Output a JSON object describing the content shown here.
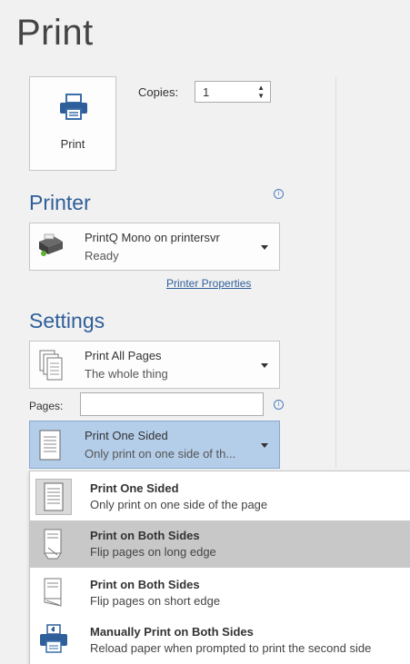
{
  "page": {
    "title": "Print"
  },
  "print_button": {
    "label": "Print",
    "icon": "printer-icon"
  },
  "copies": {
    "label": "Copies:",
    "value": "1"
  },
  "printer": {
    "section_title": "Printer",
    "name": "PrintQ Mono on printersvr",
    "status": "Ready",
    "properties_link": "Printer Properties"
  },
  "settings": {
    "section_title": "Settings",
    "pages_dropdown": {
      "title": "Print All Pages",
      "subtitle": "The whole thing"
    },
    "pages_field": {
      "label": "Pages:",
      "value": ""
    },
    "sides_dropdown": {
      "title": "Print One Sided",
      "subtitle": "Only print on one side of th..."
    }
  },
  "sides_menu": {
    "items": [
      {
        "title": "Print One Sided",
        "subtitle": "Only print on one side of the page",
        "icon": "one-sided-page-icon",
        "state": "selected"
      },
      {
        "title": "Print on Both Sides",
        "subtitle": "Flip pages on long edge",
        "icon": "flip-long-edge-icon",
        "state": "hover"
      },
      {
        "title": "Print on Both Sides",
        "subtitle": "Flip pages on short edge",
        "icon": "flip-short-edge-icon",
        "state": "normal"
      },
      {
        "title": "Manually Print on Both Sides",
        "subtitle": "Reload paper when prompted to print the second side",
        "icon": "manual-duplex-icon",
        "state": "normal"
      }
    ]
  },
  "colors": {
    "accent": "#2f5f9a",
    "selected_bg": "#b4cde9",
    "hover_bg": "#c8c8c8",
    "background": "#f1f1f1"
  }
}
